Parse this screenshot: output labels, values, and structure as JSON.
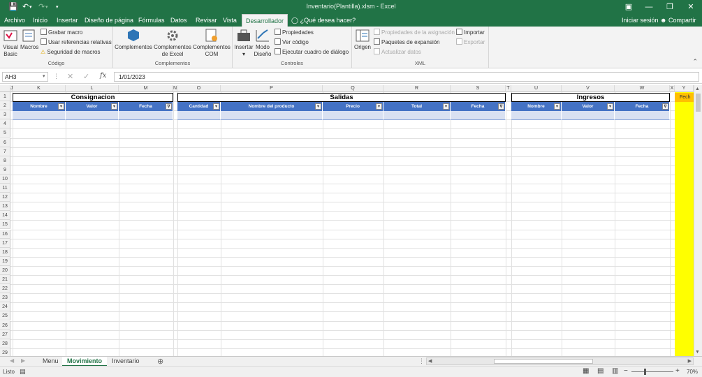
{
  "window": {
    "title": "Inventario(Plantilla).xlsm - Excel"
  },
  "tabs": [
    "Archivo",
    "Inicio",
    "Insertar",
    "Diseño de página",
    "Fórmulas",
    "Datos",
    "Revisar",
    "Vista",
    "Desarrollador"
  ],
  "active_tab": "Desarrollador",
  "tell_me": "¿Qué desea hacer?",
  "sign_in": "Iniciar sesión",
  "share": "Compartir",
  "ribbon": {
    "codigo": {
      "label": "Código",
      "visual_basic_l1": "Visual",
      "visual_basic_l2": "Basic",
      "macros": "Macros",
      "record_macro": "Grabar macro",
      "relative_refs": "Usar referencias relativas",
      "macro_security": "Seguridad de macros"
    },
    "complementos": {
      "label": "Complementos",
      "addins": "Complementos",
      "excel_addins_l1": "Complementos",
      "excel_addins_l2": "de Excel",
      "com_addins_l1": "Complementos",
      "com_addins_l2": "COM"
    },
    "controles": {
      "label": "Controles",
      "insert": "Insertar",
      "design_l1": "Modo",
      "design_l2": "Diseño",
      "properties": "Propiedades",
      "view_code": "Ver código",
      "run_dialog": "Ejecutar cuadro de diálogo"
    },
    "xml": {
      "label": "XML",
      "source": "Origen",
      "map_props": "Propiedades de la asignación",
      "expansion": "Paquetes de expansión",
      "refresh": "Actualizar datos",
      "import": "Importar",
      "export": "Exportar"
    }
  },
  "formula_bar": {
    "name_box": "AH3",
    "formula": "1/01/2023"
  },
  "columns": [
    "J",
    "K",
    "L",
    "M",
    "N",
    "O",
    "P",
    "Q",
    "R",
    "S",
    "T",
    "U",
    "V",
    "W",
    "X",
    "Y"
  ],
  "rows": [
    "1",
    "2",
    "3",
    "4",
    "5",
    "6",
    "7",
    "8",
    "9",
    "10",
    "11",
    "12",
    "13",
    "14",
    "15",
    "16",
    "17",
    "18",
    "19",
    "20",
    "21",
    "22",
    "23",
    "24",
    "25",
    "26",
    "27",
    "28",
    "29"
  ],
  "sections": {
    "consignacion": {
      "title": "Consignacion",
      "headers": [
        "Nombre",
        "Valor",
        "Fecha"
      ]
    },
    "salidas": {
      "title": "Salidas",
      "headers": [
        "Cantidad",
        "Nombre del producto",
        "Precio",
        "Total",
        "Fecha"
      ]
    },
    "ingresos": {
      "title": "Ingresos",
      "headers": [
        "Nombre",
        "Valor",
        "Fecha"
      ]
    },
    "fecha_cell": "Fech"
  },
  "sheets": [
    "Menu",
    "Movimiento",
    "Inventario"
  ],
  "active_sheet": "Movimiento",
  "status": {
    "ready": "Listo",
    "zoom": "70%"
  }
}
